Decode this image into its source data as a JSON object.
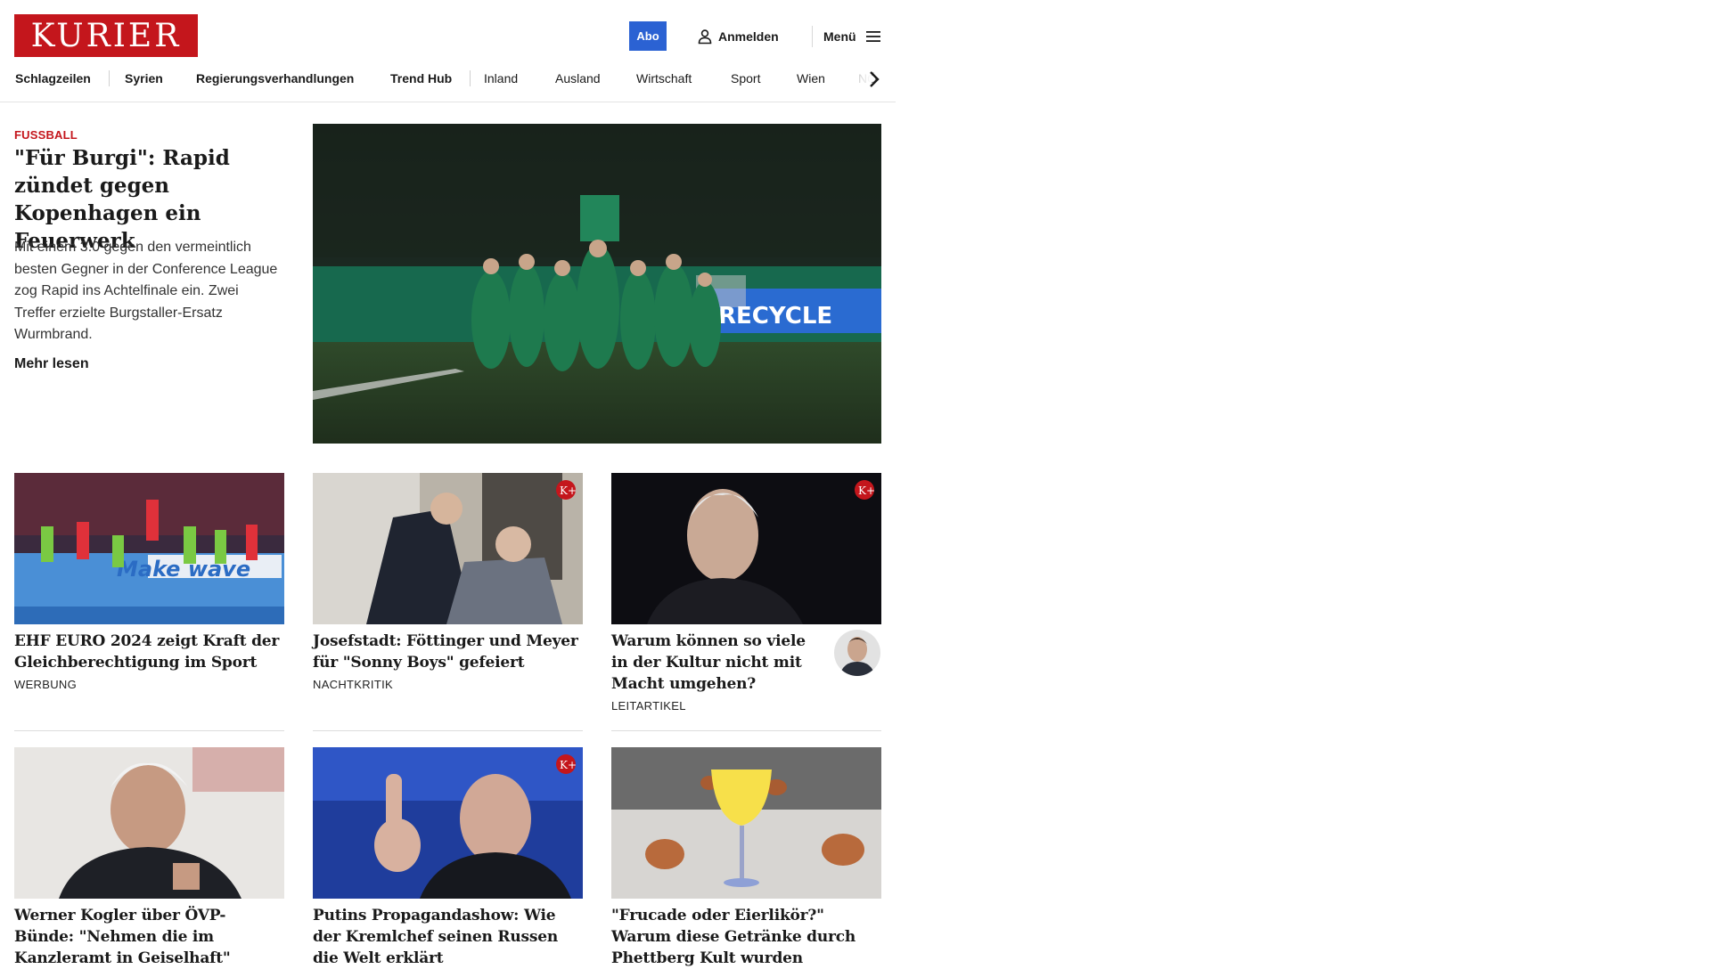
{
  "header": {
    "logo_text": "KURIER",
    "abo_label": "Abo",
    "login_label": "Anmelden",
    "menu_label": "Menü",
    "brand_color": "#c4161c",
    "accent_color": "#2b62d3"
  },
  "nav": {
    "items": [
      "Schlagzeilen",
      "Syrien",
      "Regierungsverhandlungen",
      "Trend Hub",
      "Inland",
      "Ausland",
      "Wirtschaft",
      "Sport",
      "Wien",
      "NÖ"
    ]
  },
  "hero": {
    "kicker": "FUSSBALL",
    "title": "\"Für Burgi\": Rapid zündet gegen Kopenhagen ein Feuerwerk",
    "lead": "Mit einem 3:0 gegen den vermeintlich besten Gegner in der Conference League zog Rapid ins Achtelfinale ein. Zwei Treffer erzielte Burgstaller-Ersatz Wurmbrand.",
    "more_label": "Mehr lesen",
    "image_text": "RECYCLE"
  },
  "cards": [
    {
      "title": "EHF EURO 2024 zeigt Kraft der Gleichberechtigung im Sport",
      "tag": "WERBUNG",
      "image_text": "Make wave"
    },
    {
      "title": "Josefstadt: Föttinger und Meyer für \"Sonny Boys\" gefeiert",
      "tag": "NACHTKRITIK"
    },
    {
      "title": "Warum können so viele in der Kultur nicht mit Macht umgehen?",
      "tag": "LEITARTIKEL"
    },
    {
      "title": "Werner Kogler über ÖVP-Bünde: \"Nehmen die im Kanzleramt in Geiselhaft\""
    },
    {
      "title": "Putins Propagandashow: Wie der Kremlchef seinen Russen die Welt erklärt"
    },
    {
      "title": "\"Frucade oder Eierlikör?\" Warum diese Getränke durch Phettberg Kult wurden"
    }
  ],
  "premium_badge": "K+",
  "icons": [
    "user-icon",
    "hamburger-icon",
    "chevron-right-icon",
    "k-plus-badge"
  ]
}
